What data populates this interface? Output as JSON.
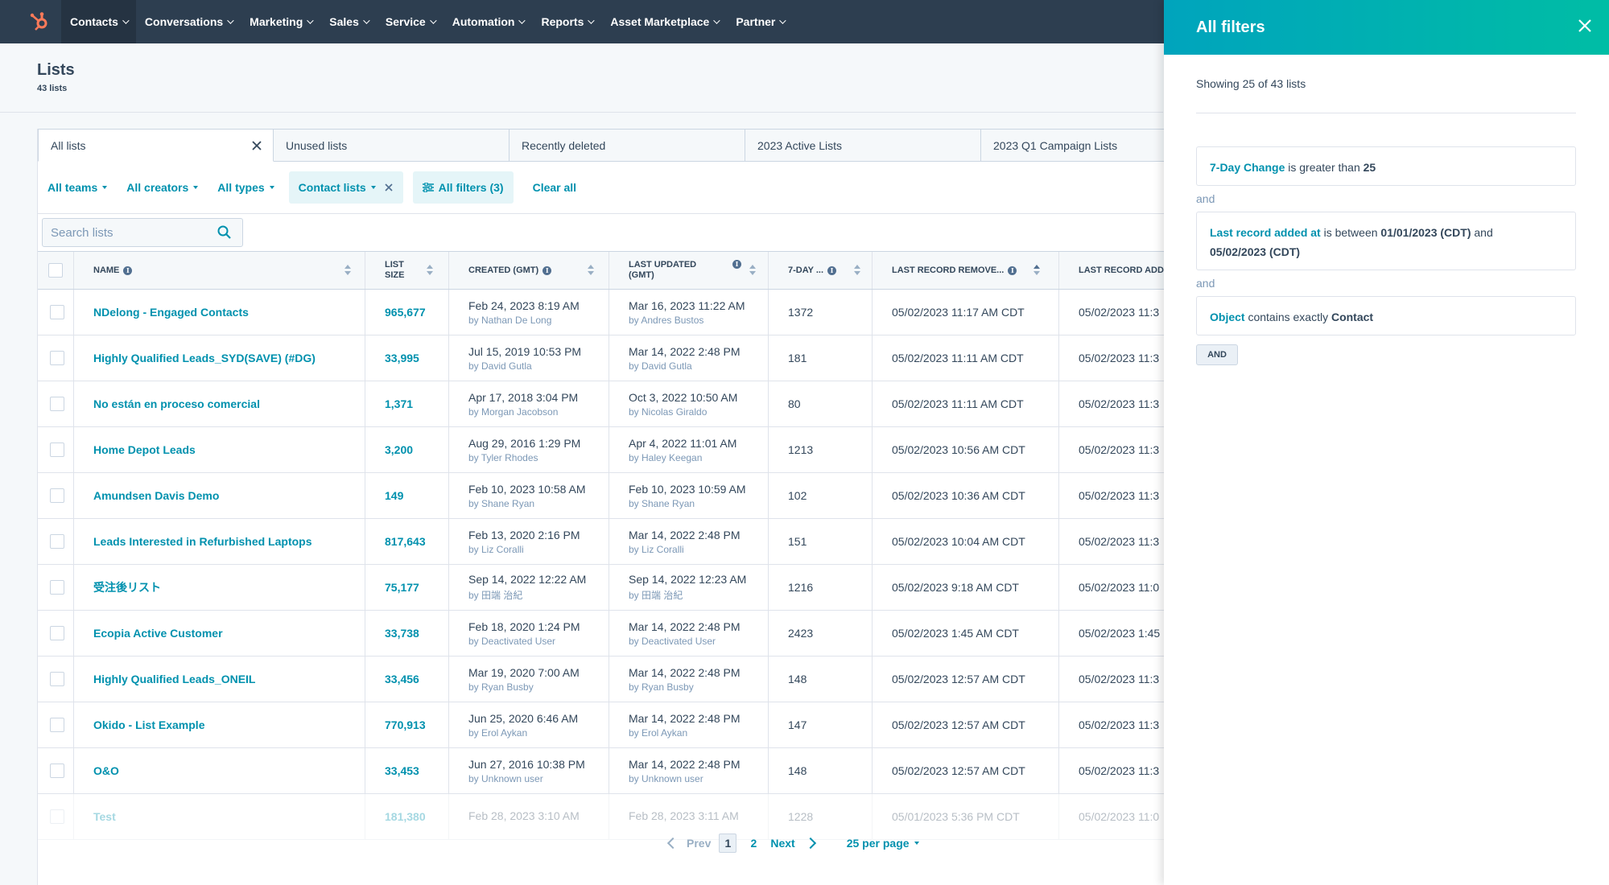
{
  "nav": {
    "items": [
      {
        "label": "Contacts",
        "active": true
      },
      {
        "label": "Conversations"
      },
      {
        "label": "Marketing"
      },
      {
        "label": "Sales"
      },
      {
        "label": "Service"
      },
      {
        "label": "Automation"
      },
      {
        "label": "Reports"
      },
      {
        "label": "Asset Marketplace"
      },
      {
        "label": "Partner"
      }
    ]
  },
  "header": {
    "title": "Lists",
    "count": "43 lists"
  },
  "view_tabs": [
    "All lists",
    "Unused lists",
    "Recently deleted",
    "2023 Active Lists",
    "2023 Q1 Campaign Lists"
  ],
  "filters": {
    "teams": "All teams",
    "creators": "All creators",
    "types": "All types",
    "contact_lists": "Contact lists",
    "all_filters": "All filters (3)",
    "clear_all": "Clear all"
  },
  "search": {
    "placeholder": "Search lists"
  },
  "table": {
    "headers": {
      "name": "Name",
      "list_size_1": "List",
      "list_size_2": "Size",
      "created": "Created (GMT)",
      "updated_1": "Last Updated",
      "updated_2": "(GMT)",
      "seven_day": "7-Day ...",
      "last_removed": "Last Record Remove...",
      "last_added": "Last Record Add"
    },
    "rows": [
      {
        "name": "NDelong - Engaged Contacts",
        "size": "965,677",
        "created": "Feb 24, 2023 8:19 AM",
        "created_by": "by Nathan De Long",
        "updated": "Mar 16, 2023 11:22 AM",
        "updated_by": "by Andres Bustos",
        "change": "1372",
        "removed": "05/02/2023 11:17 AM CDT",
        "added": "05/02/2023 11:3"
      },
      {
        "name": "Highly Qualified Leads_SYD(SAVE) (#DG)",
        "size": "33,995",
        "created": "Jul 15, 2019 10:53 PM",
        "created_by": "by David Gutla",
        "updated": "Mar 14, 2022 2:48 PM",
        "updated_by": "by David Gutla",
        "change": "181",
        "removed": "05/02/2023 11:11 AM CDT",
        "added": "05/02/2023 11:3"
      },
      {
        "name": "No están en proceso comercial",
        "size": "1,371",
        "created": "Apr 17, 2018 3:04 PM",
        "created_by": "by Morgan Jacobson",
        "updated": "Oct 3, 2022 10:50 AM",
        "updated_by": "by Nicolas Giraldo",
        "change": "80",
        "removed": "05/02/2023 11:11 AM CDT",
        "added": "05/02/2023 11:3"
      },
      {
        "name": "Home Depot Leads",
        "size": "3,200",
        "created": "Aug 29, 2016 1:29 PM",
        "created_by": "by Tyler Rhodes",
        "updated": "Apr 4, 2022 11:01 AM",
        "updated_by": "by Haley Keegan",
        "change": "1213",
        "removed": "05/02/2023 10:56 AM CDT",
        "added": "05/02/2023 11:3"
      },
      {
        "name": "Amundsen Davis Demo",
        "size": "149",
        "created": "Feb 10, 2023 10:58 AM",
        "created_by": "by Shane Ryan",
        "updated": "Feb 10, 2023 10:59 AM",
        "updated_by": "by Shane Ryan",
        "change": "102",
        "removed": "05/02/2023 10:36 AM CDT",
        "added": "05/02/2023 11:3"
      },
      {
        "name": "Leads Interested in Refurbished Laptops",
        "size": "817,643",
        "created": "Feb 13, 2020 2:16 PM",
        "created_by": "by Liz Coralli",
        "updated": "Mar 14, 2022 2:48 PM",
        "updated_by": "by Liz Coralli",
        "change": "151",
        "removed": "05/02/2023 10:04 AM CDT",
        "added": "05/02/2023 11:3"
      },
      {
        "name": "受注後リスト",
        "size": "75,177",
        "created": "Sep 14, 2022 12:22 AM",
        "created_by": "by 田端 治紀",
        "updated": "Sep 14, 2022 12:23 AM",
        "updated_by": "by 田端 治紀",
        "change": "1216",
        "removed": "05/02/2023 9:18 AM CDT",
        "added": "05/02/2023 11:0"
      },
      {
        "name": "Ecopia Active Customer",
        "size": "33,738",
        "created": "Feb 18, 2020 1:24 PM",
        "created_by": "by Deactivated User",
        "updated": "Mar 14, 2022 2:48 PM",
        "updated_by": "by Deactivated User",
        "change": "2423",
        "removed": "05/02/2023 1:45 AM CDT",
        "added": "05/02/2023 1:45"
      },
      {
        "name": "Highly Qualified Leads_ONEIL",
        "size": "33,456",
        "created": "Mar 19, 2020 7:00 AM",
        "created_by": "by Ryan Busby",
        "updated": "Mar 14, 2022 2:48 PM",
        "updated_by": "by Ryan Busby",
        "change": "148",
        "removed": "05/02/2023 12:57 AM CDT",
        "added": "05/02/2023 11:3"
      },
      {
        "name": "Okido - List Example",
        "size": "770,913",
        "created": "Jun 25, 2020 6:46 AM",
        "created_by": "by Erol Aykan",
        "updated": "Mar 14, 2022 2:48 PM",
        "updated_by": "by Erol Aykan",
        "change": "147",
        "removed": "05/02/2023 12:57 AM CDT",
        "added": "05/02/2023 11:3"
      },
      {
        "name": "O&O",
        "size": "33,453",
        "created": "Jun 27, 2016 10:38 PM",
        "created_by": "by Unknown user",
        "updated": "Mar 14, 2022 2:48 PM",
        "updated_by": "by Unknown user",
        "change": "148",
        "removed": "05/02/2023 12:57 AM CDT",
        "added": "05/02/2023 11:3"
      },
      {
        "name": "Test",
        "size": "181,380",
        "created": "Feb 28, 2023 3:10 AM",
        "created_by": "",
        "updated": "Feb 28, 2023 3:11 AM",
        "updated_by": "",
        "change": "1228",
        "removed": "05/01/2023 5:36 PM CDT",
        "added": "05/02/2023 11:0"
      }
    ]
  },
  "pagination": {
    "prev": "Prev",
    "current": "1",
    "page2": "2",
    "next": "Next",
    "per_page": "25 per page"
  },
  "panel": {
    "title": "All filters",
    "showing": "Showing 25 of 43 lists",
    "and": "and",
    "and_button": "AND",
    "filter1": {
      "prop": "7-Day Change",
      "op": " is greater than ",
      "value": "25"
    },
    "filter2": {
      "prop": "Last record added at",
      "op": " is between ",
      "value1": "01/01/2023 (CDT)",
      "mid": " and ",
      "value2": "05/02/2023 (CDT)"
    },
    "filter3": {
      "prop": "Object",
      "op": " contains exactly ",
      "value": "Contact"
    }
  },
  "colors": {
    "accent": "#0091ae",
    "nav_bg": "#2d3e50",
    "panel_header": "#00a4bd",
    "logo": "#ff7a59"
  }
}
